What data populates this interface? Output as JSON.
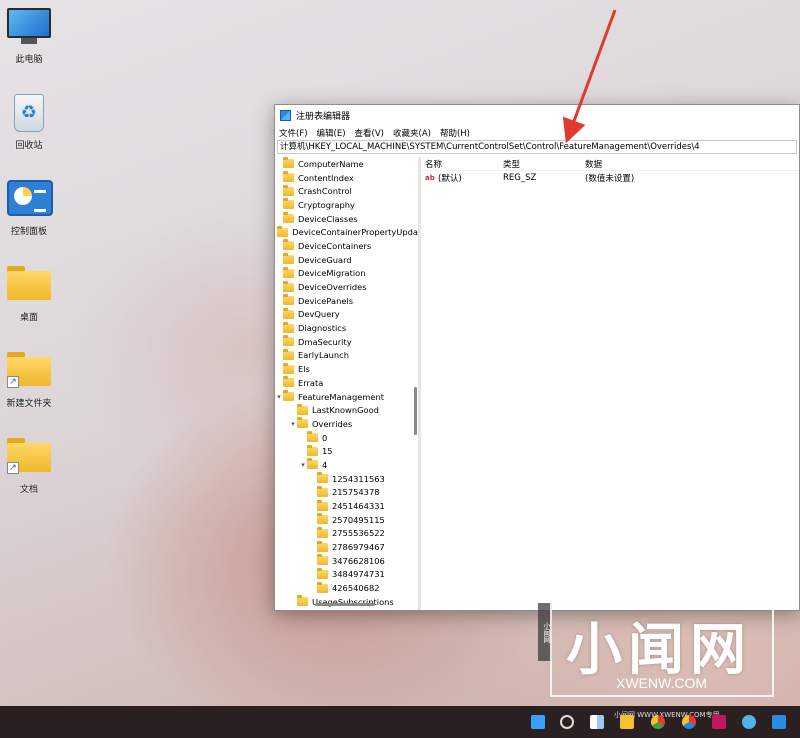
{
  "desktop": {
    "icons": [
      {
        "label": "此电脑"
      },
      {
        "label": "回收站"
      },
      {
        "label": "控制面板"
      },
      {
        "label": "桌面"
      },
      {
        "label": "新建文件夹"
      },
      {
        "label": "文档"
      }
    ]
  },
  "window": {
    "title": "注册表编辑器",
    "menu": [
      "文件(F)",
      "编辑(E)",
      "查看(V)",
      "收藏夹(A)",
      "帮助(H)"
    ],
    "address": "计算机\\HKEY_LOCAL_MACHINE\\SYSTEM\\CurrentControlSet\\Control\\FeatureManagement\\Overrides\\4",
    "tree": [
      {
        "label": "ComputerName"
      },
      {
        "label": "ContentIndex"
      },
      {
        "label": "CrashControl"
      },
      {
        "label": "Cryptography"
      },
      {
        "label": "DeviceClasses"
      },
      {
        "label": "DeviceContainerPropertyUpda"
      },
      {
        "label": "DeviceContainers"
      },
      {
        "label": "DeviceGuard"
      },
      {
        "label": "DeviceMigration"
      },
      {
        "label": "DeviceOverrides"
      },
      {
        "label": "DevicePanels"
      },
      {
        "label": "DevQuery"
      },
      {
        "label": "Diagnostics"
      },
      {
        "label": "DmaSecurity"
      },
      {
        "label": "EarlyLaunch"
      },
      {
        "label": "Els"
      },
      {
        "label": "Errata"
      },
      {
        "label": "FeatureManagement"
      },
      {
        "label": "LastKnownGood"
      },
      {
        "label": "Overrides"
      },
      {
        "label": "0"
      },
      {
        "label": "15"
      },
      {
        "label": "4"
      },
      {
        "label": "1254311563"
      },
      {
        "label": "215754378"
      },
      {
        "label": "2451464331"
      },
      {
        "label": "2570495115"
      },
      {
        "label": "2755536522"
      },
      {
        "label": "2786979467"
      },
      {
        "label": "3476628106"
      },
      {
        "label": "3484974731"
      },
      {
        "label": "426540682"
      },
      {
        "label": "UsageSubscriptions"
      }
    ],
    "values": {
      "headers": [
        "名称",
        "类型",
        "数据"
      ],
      "rows": [
        {
          "name": "(默认)",
          "type": "REG_SZ",
          "data": "(数值未设置)"
        }
      ]
    }
  },
  "watermark": {
    "text": "小闻网",
    "url": "XWENW.COM",
    "side": "小闻网",
    "footer": "小闻网 WWW.XWENW.COM专用"
  }
}
